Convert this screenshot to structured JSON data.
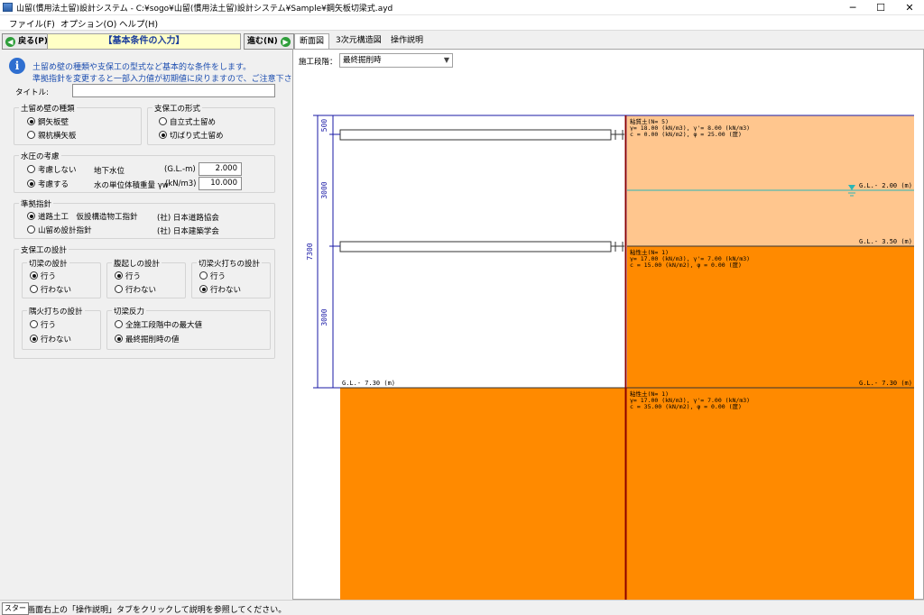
{
  "window": {
    "title": "山留(慣用法土留)設計システム - C:¥sogo¥山留(慣用法土留)設計システム¥Sample¥鋼矢板切梁式.ayd",
    "minimize": "─",
    "maximize": "☐",
    "close": "✕"
  },
  "menu": [
    "ファイル(F)",
    "オプション(O)",
    "ヘルプ(H)"
  ],
  "nav": {
    "back": "戻る(P)",
    "forward": "進む(N)",
    "step_title": "【基本条件の入力】"
  },
  "info": {
    "line1": "土留め壁の種類や支保工の型式など基本的な条件をします。",
    "line2": "準拠指針を変更すると一部入力値が初期値に戻りますので、ご注意下さい。"
  },
  "form": {
    "title_label": "タイトル:",
    "title_value": "",
    "wall_type": {
      "label": "土留め壁の種類",
      "options": [
        "鋼矢板壁",
        "親杭横矢板"
      ],
      "selected": 0
    },
    "support_type": {
      "label": "支保工の形式",
      "options": [
        "自立式土留め",
        "切ばり式土留め"
      ],
      "selected": 1
    },
    "water": {
      "label": "水圧の考慮",
      "options": [
        "考慮しない",
        "考慮する"
      ],
      "selected": 1,
      "gw_label": "地下水位",
      "gw_unit": "(G.L.-m)",
      "gw_value": "2.000",
      "unit_weight_label": "水の単位体積重量 γw",
      "unit_weight_unit": "(kN/m3)",
      "unit_weight_value": "10.000"
    },
    "standard": {
      "label": "準拠指針",
      "options": [
        "道路土工　仮設構造物工指針",
        "山留め設計指針"
      ],
      "orgs": [
        "(社) 日本道路協会",
        "(社) 日本建築学会"
      ],
      "selected": 0
    },
    "support_design": {
      "label": "支保工の設計",
      "strut": {
        "label": "切梁の設計",
        "options": [
          "行う",
          "行わない"
        ],
        "selected": 0
      },
      "wale": {
        "label": "腹起しの設計",
        "options": [
          "行う",
          "行わない"
        ],
        "selected": 0
      },
      "strut_brace": {
        "label": "切梁火打ちの設計",
        "options": [
          "行う",
          "行わない"
        ],
        "selected": 1
      },
      "corner_brace": {
        "label": "隅火打ちの設計",
        "options": [
          "行う",
          "行わない"
        ],
        "selected": 1
      },
      "reaction": {
        "label": "切梁反力",
        "options": [
          "全施工段階中の最大値",
          "最終掘削時の値"
        ],
        "selected": 1
      }
    }
  },
  "tabs": [
    "断面図",
    "3次元構造図",
    "操作説明"
  ],
  "stage": {
    "label": "施工段階：",
    "value": "最終掘削時"
  },
  "drawing": {
    "colors": {
      "sand": "#ffc68e",
      "clay": "#ff8a00",
      "wall": "#8b0000",
      "dim": "#1a1aa6",
      "water": "#2bb5b5"
    },
    "dims": [
      "500",
      "3000",
      "3000",
      "7300"
    ],
    "levels": [
      "G.L.-  2.00 (m)",
      "G.L.-  3.50 (m)",
      "G.L.-  7.30 (m)",
      "G.L.-  7.30 (m)"
    ],
    "layers": [
      {
        "name": "粘質土(N= 5)",
        "gamma": "γ=  18.00 (kN/m3), γ'=  8.00 (kN/m3)",
        "c_phi": "c =   0.00 (kN/m2), φ = 25.00 (度)"
      },
      {
        "name": "粘性土(N= 1)",
        "gamma": "γ=  17.00 (kN/m3), γ'=  7.00 (kN/m3)",
        "c_phi": "c =  15.00 (kN/m2), φ =  0.00 (度)"
      },
      {
        "name": "粘性土(N= 1)",
        "gamma": "γ=  17.00 (kN/m3), γ'=  7.00 (kN/m3)",
        "c_phi": "c =  35.00 (kN/m2), φ =  0.00 (度)"
      }
    ]
  },
  "status": {
    "start": "スタート",
    "text": "画面右上の「操作説明」タブをクリックして説明を参照してください。"
  }
}
